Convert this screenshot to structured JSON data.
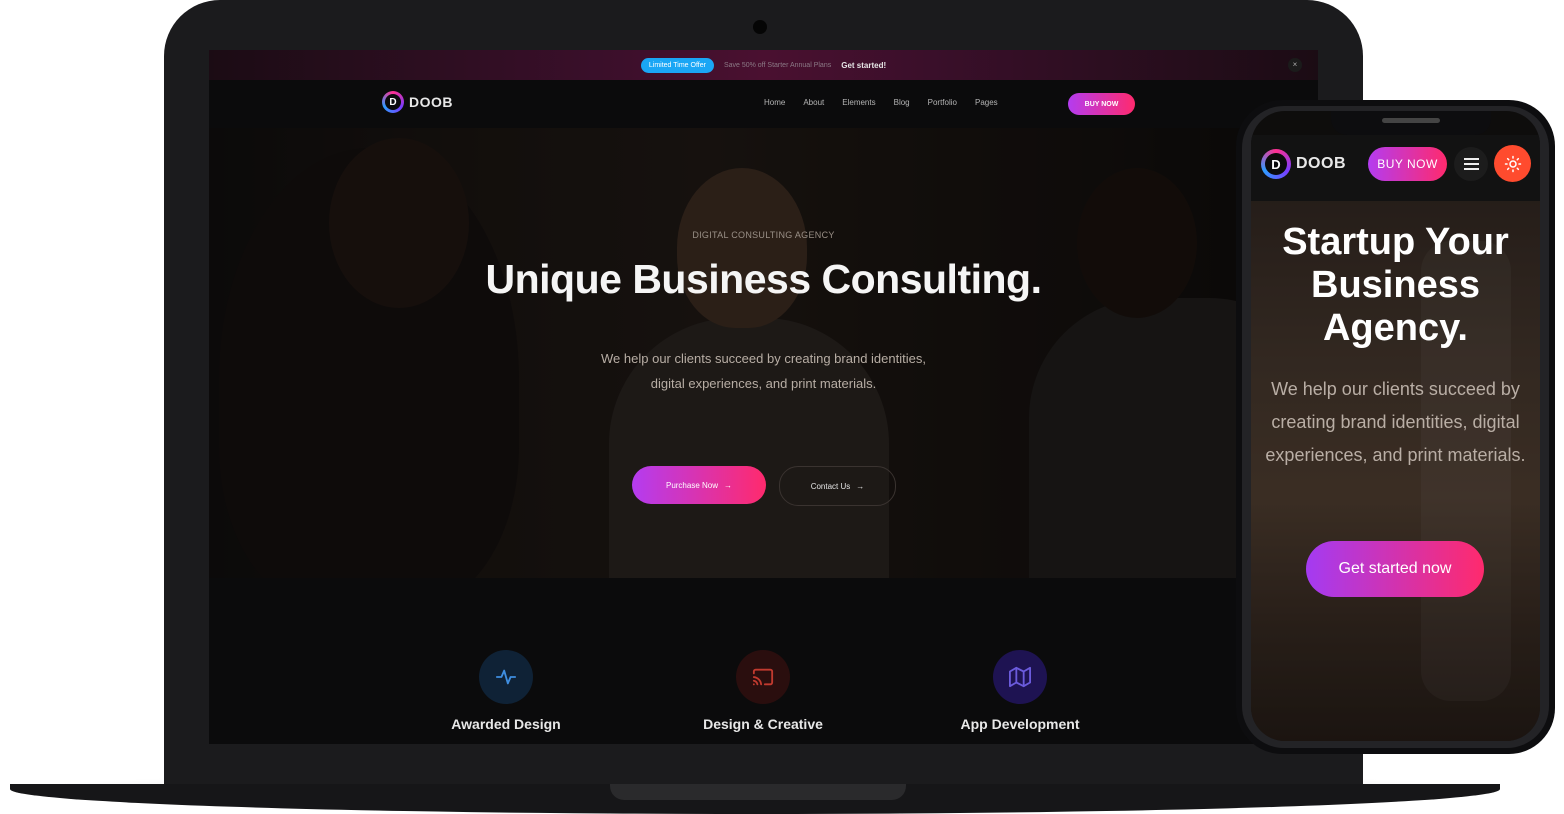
{
  "laptop": {
    "promo": {
      "badge": "Limited Time Offer",
      "text": "Save 50% off Starter Annual Plans",
      "link": "Get started!",
      "close_icon": "×"
    },
    "brand": {
      "mark": "D",
      "name": "DOOB"
    },
    "nav": {
      "items": [
        "Home",
        "About",
        "Elements",
        "Blog",
        "Portfolio",
        "Pages"
      ],
      "buy_label": "BUY NOW"
    },
    "hero": {
      "kicker": "DIGITAL CONSULTING AGENCY",
      "title": "Unique Business Consulting.",
      "subtitle_line1": "We help our clients succeed by creating brand identities,",
      "subtitle_line2": "digital experiences, and print materials.",
      "primary_cta": "Purchase Now",
      "secondary_cta": "Contact Us",
      "arrow": "→"
    },
    "services": [
      {
        "title": "Awarded Design",
        "icon": "activity-icon",
        "color": "#0f2236"
      },
      {
        "title": "Design & Creative",
        "icon": "cast-icon",
        "color": "#2a0e0e"
      },
      {
        "title": "App Development",
        "icon": "map-icon",
        "color": "#1e1352"
      }
    ]
  },
  "phone": {
    "brand": {
      "mark": "D",
      "name": "DOOB"
    },
    "buy_label": "BUY NOW",
    "menu_icon": "hamburger-menu-icon",
    "theme_icon": "sun-icon",
    "hero": {
      "title_line1": "Startup Your",
      "title_line2": "Business",
      "title_line3": "Agency.",
      "subtitle": "We help our clients succeed by creating brand identities, digital experiences, and print materials.",
      "cta": "Get started now"
    }
  },
  "colors": {
    "accent_gradient_start": "#b43cf0",
    "accent_gradient_end": "#ff2a6d",
    "promo_badge": "#1aa6f5",
    "theme_toggle": "#ff4b2e"
  }
}
